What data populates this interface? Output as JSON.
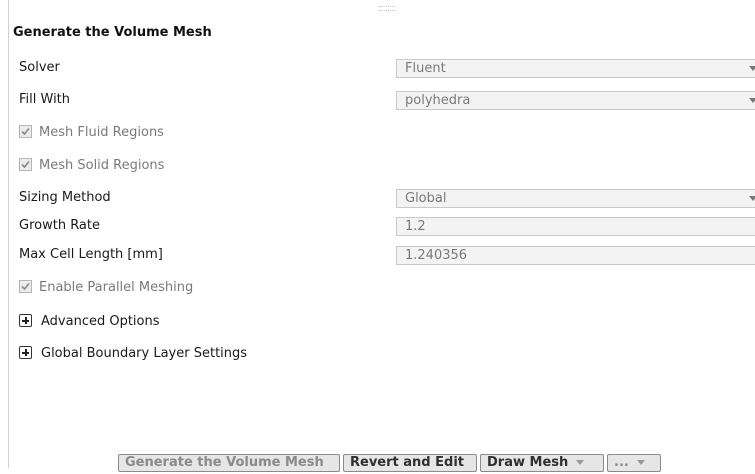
{
  "section_title": "Generate the Volume Mesh",
  "fields": {
    "solver": {
      "label": "Solver",
      "value": "Fluent"
    },
    "fill_with": {
      "label": "Fill With",
      "value": "polyhedra"
    },
    "sizing_method": {
      "label": "Sizing Method",
      "value": "Global"
    },
    "growth_rate": {
      "label": "Growth Rate",
      "value": "1.2"
    },
    "max_cell_length": {
      "label": "Max Cell Length [mm]",
      "value": "1.240356"
    }
  },
  "checkboxes": {
    "mesh_fluid": {
      "label": "Mesh Fluid Regions",
      "checked": true
    },
    "mesh_solid": {
      "label": "Mesh Solid Regions",
      "checked": true
    },
    "parallel": {
      "label": "Enable Parallel Meshing",
      "checked": true
    }
  },
  "expanders": {
    "advanced": {
      "label": "Advanced Options"
    },
    "boundary_layer": {
      "label": "Global Boundary Layer Settings"
    }
  },
  "buttons": {
    "generate": "Generate the Volume Mesh",
    "revert": "Revert and Edit",
    "draw": "Draw Mesh",
    "more": "..."
  }
}
